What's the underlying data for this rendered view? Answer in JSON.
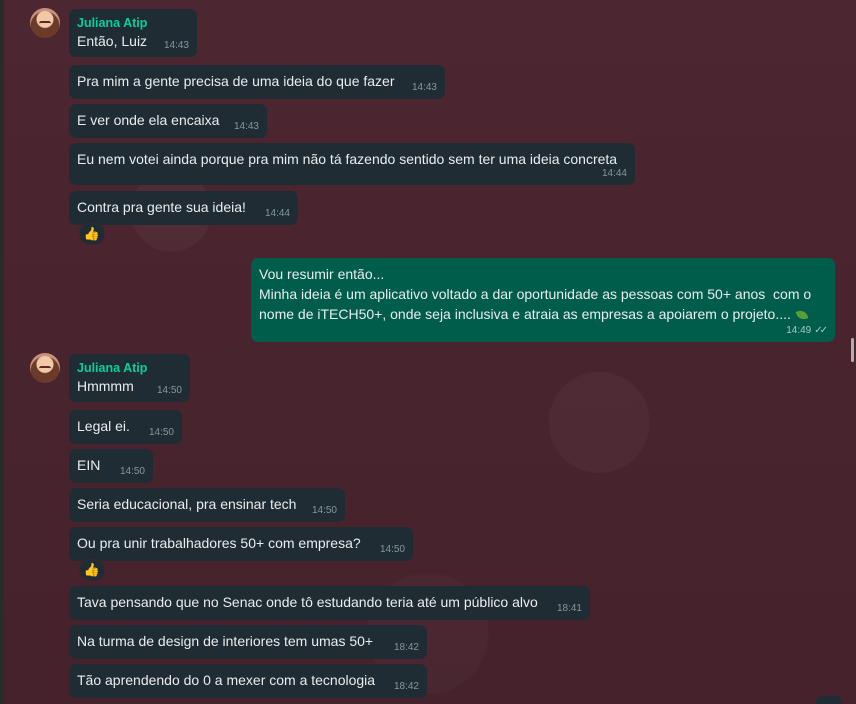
{
  "contact": {
    "name": "Juliana Atip"
  },
  "messages": [
    {
      "text": "Então, Luiz",
      "time": "14:43"
    },
    {
      "text": "Pra mim a gente precisa de uma ideia do que fazer",
      "time": "14:43"
    },
    {
      "text": "E ver onde ela encaixa",
      "time": "14:43"
    },
    {
      "text": "Eu nem votei ainda porque pra mim não tá fazendo sentido sem ter uma ideia concreta",
      "time": "14:44"
    },
    {
      "text": "Contra pra gente sua ideia!",
      "time": "14:44",
      "reaction": "👍"
    },
    {
      "text": "Vou resumir então...\nMinha ideia é um aplicativo voltado a dar oportunidade as pessoas com 50+ anos  com o nome de iTECH50+, onde seja inclusiva e atraia as empresas a apoiarem o projeto....",
      "time": "14:49",
      "outgoing": true,
      "status": "read"
    },
    {
      "text": "Hmmmm",
      "time": "14:50"
    },
    {
      "text": "Legal ei.",
      "time": "14:50"
    },
    {
      "text": "EIN",
      "time": "14:50"
    },
    {
      "text": "Seria educacional, pra ensinar tech",
      "time": "14:50"
    },
    {
      "text": "Ou pra unir trabalhadores 50+ com empresa?",
      "time": "14:50",
      "reaction": "👍"
    },
    {
      "text": "Tava pensando que no Senac onde tô estudando teria até um público alvo",
      "time": "18:41"
    },
    {
      "text": "Na turma de design de interiores tem umas 50+",
      "time": "18:42"
    },
    {
      "text": "Tão aprendendo do 0 a mexer com a tecnologia",
      "time": "18:42"
    }
  ],
  "icons": {
    "avatar": "contact-avatar",
    "read_receipt": "double-check-icon",
    "reaction": "thumbs-up-icon",
    "emoji_leaf": "leaf-emoji-icon"
  },
  "colors": {
    "incoming": "#202c33",
    "outgoing": "#005c4b",
    "sender_name": "#06cf9c",
    "background": "#4a2530"
  }
}
